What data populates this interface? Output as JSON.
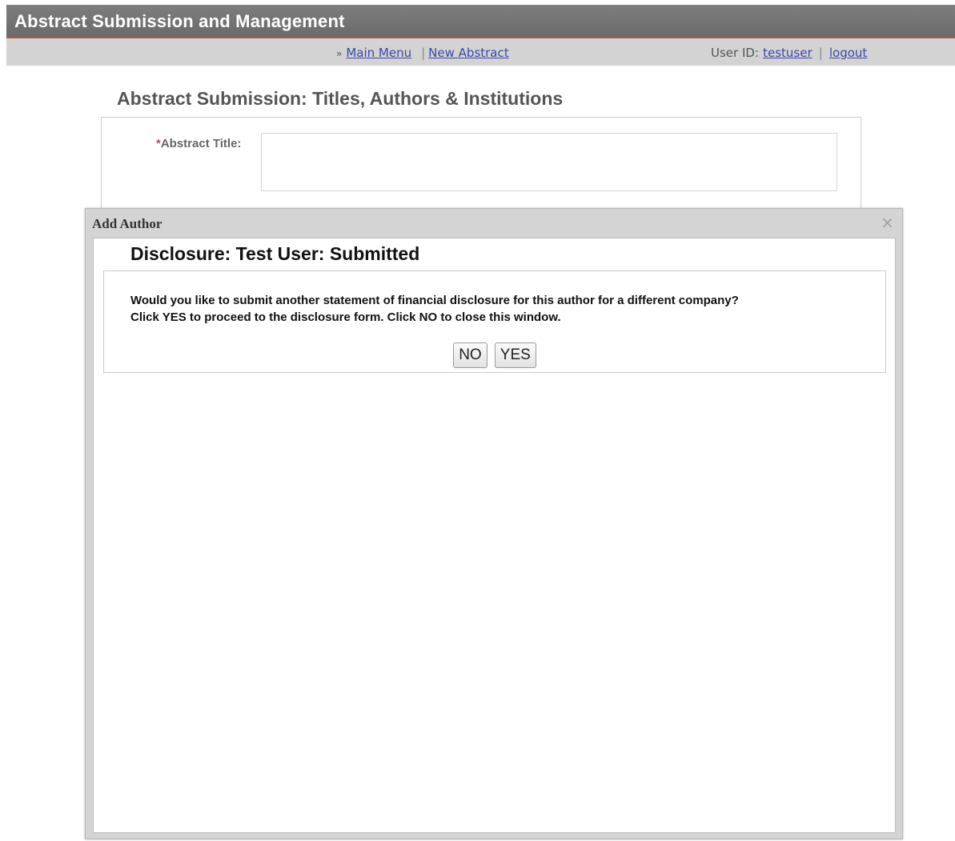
{
  "header": {
    "title": "Abstract Submission and Management"
  },
  "nav": {
    "raquo": "»",
    "main_menu": "Main Menu",
    "separator": "|",
    "new_abstract": "New Abstract",
    "user_id_label": "User ID:",
    "user_id": "testuser",
    "separator2": "|",
    "logout": "logout"
  },
  "page": {
    "heading": "Abstract Submission: Titles, Authors & Institutions",
    "abstract_title_required": "*",
    "abstract_title_label": "Abstract Title:",
    "abstract_title_value": ""
  },
  "modal": {
    "title": "Add Author",
    "close_glyph": "×",
    "heading": "Disclosure: Test User: Submitted",
    "message_line1": "Would you like to submit another statement of financial disclosure for this author for a different company?",
    "message_line2": "Click YES to proceed to the disclosure form. Click NO to close this window.",
    "no_label": "NO",
    "yes_label": "YES"
  },
  "colors": {
    "header_bg": "#737373",
    "header_border": "#c0504d",
    "nav_bg": "#d3d3d3",
    "link": "#3a48a8",
    "required": "#c0504d"
  }
}
